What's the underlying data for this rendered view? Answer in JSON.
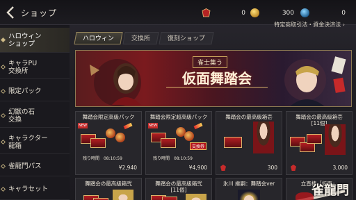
{
  "header": {
    "back_icon": "chevron-left-icon",
    "title": "ショップ",
    "currencies": [
      {
        "icon": "red-gem-icon",
        "value": "0",
        "color": "#c62a2a"
      },
      {
        "icon": "gold-coin-icon",
        "value": "300",
        "color": "#d6a23a"
      },
      {
        "icon": "blue-orb-icon",
        "value": "0",
        "color": "#2a8ac6"
      }
    ],
    "legal_link": "特定商取引法・資金決済法"
  },
  "sidebar": {
    "items": [
      {
        "label_line1": "ハロウィン",
        "label_line2": "ショップ",
        "active": true
      },
      {
        "label_line1": "キャラPU",
        "label_line2": "交換所",
        "active": false
      },
      {
        "label_line1": "限定パック",
        "label_line2": "",
        "active": false
      },
      {
        "label_line1": "幻獣の石",
        "label_line2": "交換",
        "active": false
      },
      {
        "label_line1": "キャラクター",
        "label_line2": "龍箱",
        "active": false
      },
      {
        "label_line1": "雀龍門パス",
        "label_line2": "",
        "active": false
      },
      {
        "label_line1": "キャラセット",
        "label_line2": "",
        "active": false
      }
    ]
  },
  "tabs": [
    {
      "label": "ハロウィン",
      "active": true
    },
    {
      "label": "交換所",
      "active": false
    },
    {
      "label": "復刻ショップ",
      "active": false
    }
  ],
  "banner": {
    "subtitle": "雀士集う",
    "title": "仮面舞踏会"
  },
  "cards": [
    {
      "name": "舞踏会限定高級パック",
      "name2": "",
      "timer_label": "残り時間",
      "timer": "08:10:59",
      "price": "¥2,940",
      "badge": "",
      "currency": "yen"
    },
    {
      "name": "舞踏会限定超高級パック",
      "name2": "",
      "timer_label": "残り時間",
      "timer": "08:10:59",
      "price": "¥4,900",
      "badge": "交換券",
      "currency": "yen"
    },
    {
      "name": "舞踏会の最高級箱壱",
      "name2": "",
      "timer_label": "",
      "timer": "",
      "price": "300",
      "badge": "",
      "currency": "gem"
    },
    {
      "name": "舞踏会の最高級箱壱",
      "name2": "[11個]",
      "timer_label": "",
      "timer": "",
      "price": "3,000",
      "badge": "",
      "currency": "gem"
    },
    {
      "name": "舞踏会の最高級箱弐",
      "name2": "",
      "timer_label": "",
      "timer": "",
      "price": "",
      "badge": "",
      "currency": ""
    },
    {
      "name": "舞踏会の最高級箱弐",
      "name2": "[11個]",
      "timer_label": "",
      "timer": "",
      "price": "",
      "badge": "",
      "currency": ""
    },
    {
      "name": "氷川 継嗣：舞踏会ver",
      "name2": "",
      "timer_label": "",
      "timer": "",
      "price": "",
      "badge": "",
      "currency": ""
    },
    {
      "name": "立直棒「仮面」",
      "name2": "",
      "timer_label": "",
      "timer": "",
      "price": "",
      "badge": "",
      "currency": ""
    }
  ],
  "watermark": "雀龍門"
}
